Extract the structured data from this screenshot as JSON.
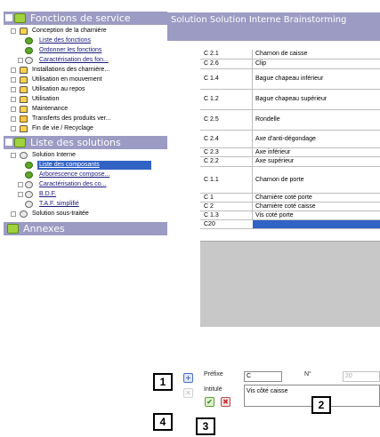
{
  "tree": {
    "sections": [
      {
        "label": "Fonctions de service",
        "expanded": true
      },
      {
        "label": "Liste des solutions",
        "expanded": true
      },
      {
        "label": "Annexes",
        "expanded": false
      }
    ],
    "service_items": [
      {
        "label": "Conception de la charnière",
        "link": false
      },
      {
        "label": "Liste des fonctions",
        "link": true
      },
      {
        "label": "Ordonner les fonctions",
        "link": true
      },
      {
        "label": "Caractérisation des fon...",
        "link": true
      },
      {
        "label": "Installations des charnière...",
        "link": false
      },
      {
        "label": "Utilisation en mouvement",
        "link": false
      },
      {
        "label": "Utilisation au repos",
        "link": false
      },
      {
        "label": "Utilisation",
        "link": false
      },
      {
        "label": "Maintenance",
        "link": false
      },
      {
        "label": "Transferts des produits ver...",
        "link": false
      },
      {
        "label": "Fin de vie / Recyclage",
        "link": false
      }
    ],
    "solution_items": [
      {
        "label": "Solution Interne",
        "link": false
      },
      {
        "label": "Liste des composants",
        "link": true,
        "selected": true
      },
      {
        "label": "Arborescence compose...",
        "link": true
      },
      {
        "label": "Caractérisation des co...",
        "link": true
      },
      {
        "label": "B.D.F.",
        "link": true
      },
      {
        "label": "T.A.F. simplifié",
        "link": true
      },
      {
        "label": "Solution sous-traitée",
        "link": false
      }
    ]
  },
  "detail": {
    "header": "Solution  Solution Interne Brainstorming",
    "parts": [
      {
        "code": "C 2.1",
        "label": "Charnon de caisse"
      },
      {
        "code": "C 2.6",
        "label": "Clip"
      },
      {
        "code": "C 1.4",
        "label": "Bague chapeau inférieur"
      },
      {
        "code": "C 1.2",
        "label": "Bague chapeau supérieur"
      },
      {
        "code": "C 2.5",
        "label": "Rondelle"
      },
      {
        "code": "C 2.4",
        "label": "Axe d'anti-dégondage"
      },
      {
        "code": "C 2.3",
        "label": "Axe inférieur"
      },
      {
        "code": "C 2.2",
        "label": "Axe supérieur"
      },
      {
        "code": "C 1.1",
        "label": "Charnon de porte"
      },
      {
        "code": "C 1",
        "label": "Charnière coté porte"
      },
      {
        "code": "C 2",
        "label": "Charnière coté caisse"
      },
      {
        "code": "C 1.3",
        "label": "Vis coté porte"
      },
      {
        "code": "C20",
        "label": ""
      }
    ]
  },
  "form": {
    "prefix_label": "Préfixe",
    "prefix_value": "C",
    "number_label": "N°",
    "number_value": "20",
    "title_label": "Intitulé",
    "title_value": "Vis côté caisse"
  },
  "callouts": [
    "1",
    "2",
    "3",
    "4"
  ],
  "colors": {
    "section_header": "#9b9bc3",
    "selection": "#3163c5",
    "grey_area": "#c8c8c8"
  }
}
